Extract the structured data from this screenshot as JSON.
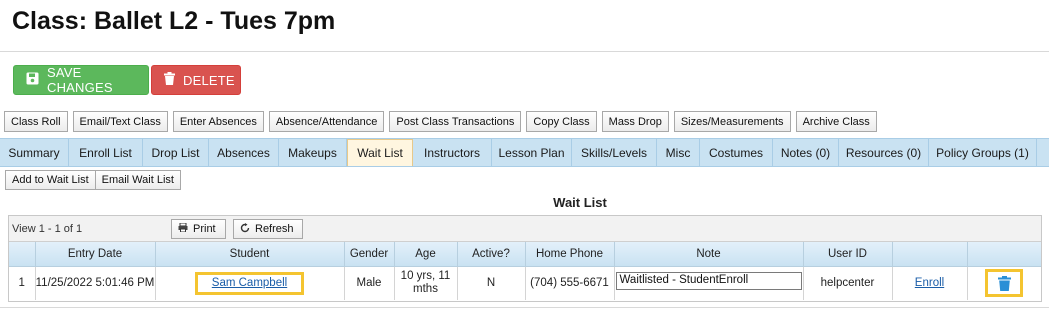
{
  "page": {
    "title": "Class: Ballet L2 - Tues 7pm"
  },
  "actions": {
    "save_label": "SAVE CHANGES",
    "delete_label": "DELETE"
  },
  "toolbar": [
    "Class Roll",
    "Email/Text Class",
    "Enter Absences",
    "Absence/Attendance",
    "Post Class Transactions",
    "Copy Class",
    "Mass Drop",
    "Sizes/Measurements",
    "Archive Class"
  ],
  "tabs": [
    "Summary",
    "Enroll List",
    "Drop List",
    "Absences",
    "Makeups",
    "Wait List",
    "Instructors",
    "Lesson Plan",
    "Skills/Levels",
    "Misc",
    "Costumes",
    "Notes (0)",
    "Resources (0)",
    "Policy Groups (1)"
  ],
  "active_tab": "Wait List",
  "subtoolbar": [
    "Add to Wait List",
    "Email Wait List"
  ],
  "grid": {
    "title": "Wait List",
    "pager_text": "View 1 - 1 of 1",
    "print_label": "Print",
    "refresh_label": "Refresh",
    "columns": [
      "",
      "Entry Date",
      "Student",
      "Gender",
      "Age",
      "Active?",
      "Home Phone",
      "Note",
      "User ID",
      "",
      ""
    ],
    "rows": [
      {
        "index": "1",
        "entry_date": "11/25/2022 5:01:46 PM",
        "student": "Sam Campbell",
        "gender": "Male",
        "age": "10 yrs, 11 mths",
        "active": "N",
        "home_phone": "(704) 555-6671",
        "note": "Waitlisted - StudentEnroll",
        "user_id": "helpcenter",
        "enroll_label": "Enroll"
      }
    ]
  },
  "colors": {
    "save": "#5cb85c",
    "delete": "#d9534f",
    "tab_bar": "#c9e2f2",
    "active_tab": "#fff6e0",
    "highlight": "#f4c430",
    "link": "#1a5da8",
    "trash": "#2a8fd6"
  }
}
